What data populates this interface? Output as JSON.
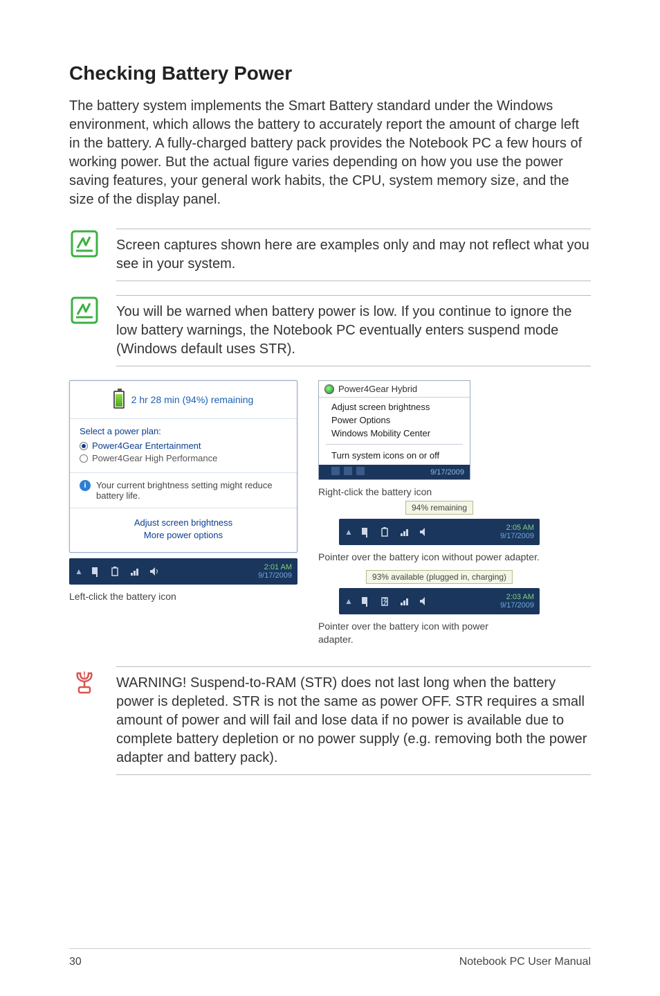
{
  "heading": "Checking Battery Power",
  "intro": "The battery system implements the Smart Battery standard under the Windows environment, which allows the battery to accurately report the amount of charge left in the battery. A fully-charged battery pack provides the Notebook PC a few hours of working power. But the actual figure varies depending on how you use the power saving features, your general work habits, the CPU, system memory size, and the size of the display panel.",
  "note1": "Screen captures shown here are examples only and may not reflect what you see in your system.",
  "note2": "You will be warned when battery power is low. If you continue to ignore the low battery warnings, the Notebook PC eventually enters suspend mode (Windows default uses STR).",
  "warning": "WARNING!  Suspend-to-RAM (STR) does not last long when the battery power is depleted. STR is not the same as power OFF. STR requires a small amount of power and will fail and lose data if no power is available due to complete battery depletion or no power supply (e.g. removing both the power adapter and battery pack).",
  "left_popup": {
    "remaining": "2 hr 28 min (94%) remaining",
    "select_plan": "Select a power plan:",
    "plan1": "Power4Gear Entertainment",
    "plan2": "Power4Gear High Performance",
    "brightness_note": "Your current brightness setting might reduce battery life.",
    "link1": "Adjust screen brightness",
    "link2": "More power options"
  },
  "left_tray": {
    "time": "2:01 AM",
    "date": "9/17/2009"
  },
  "left_caption": "Left-click the battery icon",
  "ctx": {
    "title": "Power4Gear Hybrid",
    "i1": "Adjust screen brightness",
    "i2": "Power Options",
    "i3": "Windows Mobility Center",
    "i4": "Turn system icons on or off",
    "date": "9/17/2009"
  },
  "ctx_caption": "Right-click the battery icon",
  "tray2": {
    "tooltip": "94% remaining",
    "time": "2:05 AM",
    "date": "9/17/2009"
  },
  "tray2_caption": "Pointer over the battery icon without power adapter.",
  "tray3": {
    "tooltip": "93% available (plugged in, charging)",
    "time": "2:03 AM",
    "date": "9/17/2009"
  },
  "tray3_caption": "Pointer over the battery icon with power adapter.",
  "footer": {
    "page": "30",
    "title": "Notebook PC User Manual"
  }
}
